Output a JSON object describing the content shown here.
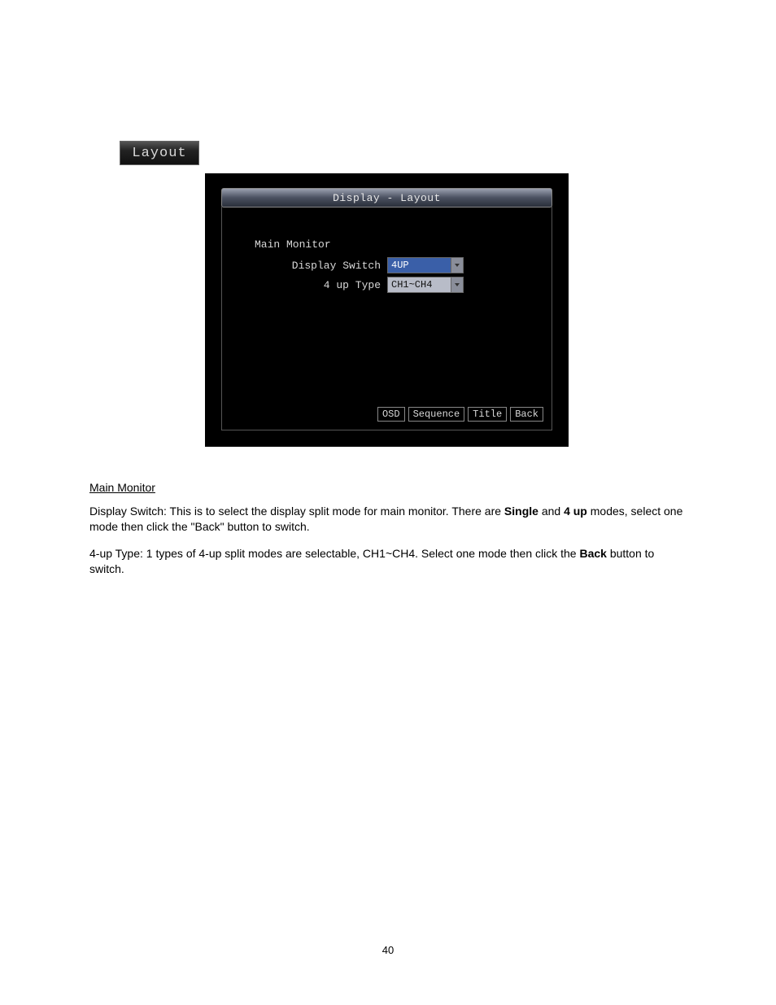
{
  "layout_btn_label": "Layout",
  "dvr": {
    "title": "Display - Layout",
    "section": "Main Monitor",
    "row1_label": "Display Switch",
    "row1_value": "4UP",
    "row2_label": "4 up Type",
    "row2_value": "CH1~CH4",
    "btn_osd": "OSD",
    "btn_sequence": "Sequence",
    "btn_title": "Title",
    "btn_back": "Back"
  },
  "body": {
    "heading": "Main Monitor",
    "para1a": "Display Switch: This is to select the display split mode for main monitor. There are ",
    "para1b": "Single",
    "para1c": " and ",
    "para1d": "4 up",
    "para1e": " modes, select one mode then click the \"Back\" button to switch.",
    "para2a": "4-up Type: 1 types of 4-up split modes are selectable, CH1~CH4. Select one mode then click the ",
    "para2b": "Back",
    "para2c": " button to switch."
  },
  "page_number": "40"
}
